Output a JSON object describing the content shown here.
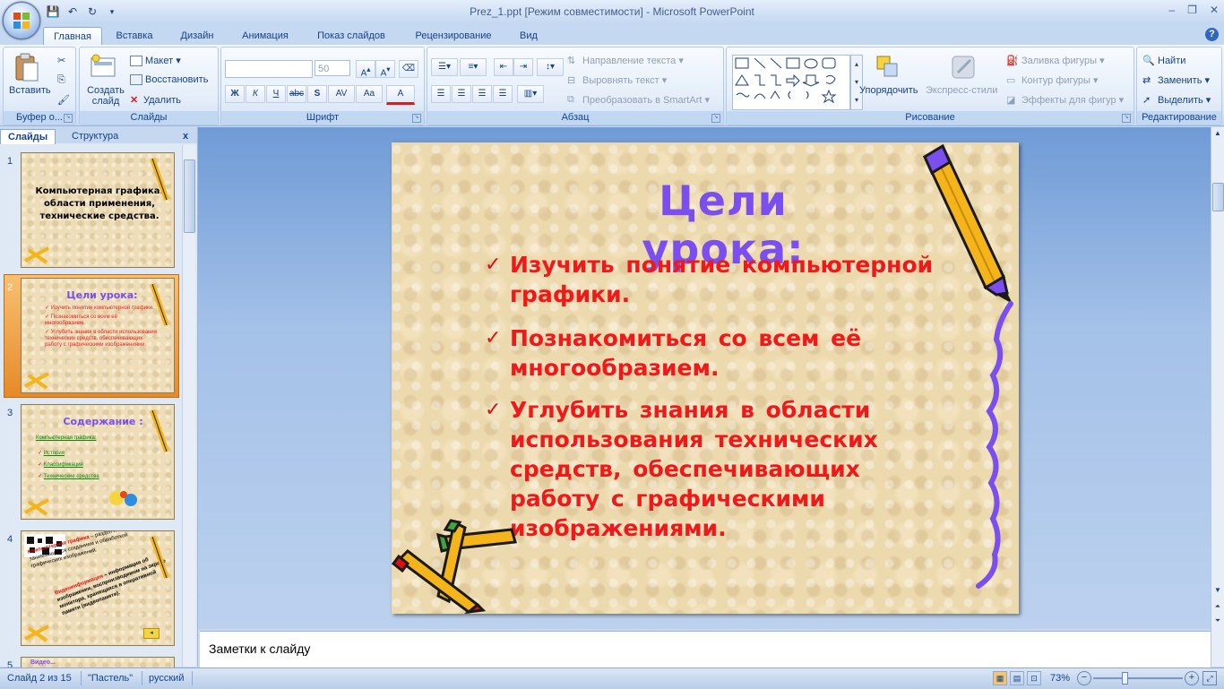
{
  "window": {
    "title": "Prez_1.ppt [Режим совместимости] - Microsoft PowerPoint",
    "controls": [
      "‒",
      "❐",
      "✕"
    ]
  },
  "tabs": [
    "Главная",
    "Вставка",
    "Дизайн",
    "Анимация",
    "Показ слайдов",
    "Рецензирование",
    "Вид"
  ],
  "ribbon": {
    "clipboard": {
      "paste": "Вставить",
      "group": "Буфер о..."
    },
    "slides": {
      "new_slide": "Создать слайд",
      "layout": "Макет",
      "reset": "Восстановить",
      "delete": "Удалить",
      "group": "Слайды"
    },
    "font": {
      "size": "50",
      "group": "Шрифт",
      "bold": "Ж",
      "italic": "К",
      "underline": "Ч",
      "strike": "abc",
      "shadow": "S",
      "spacing": "AV",
      "case": "Aa",
      "color": "A"
    },
    "paragraph": {
      "text_direction": "Направление текста",
      "align_text": "Выровнять текст",
      "smartart": "Преобразовать в SmartArt",
      "group": "Абзац"
    },
    "drawing": {
      "arrange": "Упорядочить",
      "quick_styles": "Экспресс-стили",
      "fill": "Заливка фигуры",
      "outline": "Контур фигуры",
      "effects": "Эффекты для фигур",
      "group": "Рисование"
    },
    "editing": {
      "find": "Найти",
      "replace": "Заменить",
      "select": "Выделить",
      "group": "Редактирование"
    }
  },
  "left_pane": {
    "tab_slides": "Слайды",
    "tab_outline": "Структура",
    "close": "x",
    "thumbnails": [
      {
        "num": "1",
        "text": "Компьютерная графика: области применения, технические средства."
      },
      {
        "num": "2",
        "title": "Цели урока:",
        "items": [
          "Изучить понятие компьютерной графики.",
          "Познакомиться со всем её многообразием.",
          "Углубить знания в области использования технических средств, обеспечивающих работу с графическими изображениями."
        ]
      },
      {
        "num": "3",
        "title": "Содержание :",
        "link": "Компьютерная графика:",
        "items": [
          "История",
          "Классификация",
          "Технические средства"
        ]
      },
      {
        "num": "4",
        "term1": "Компьютерная графика",
        "text1": "– раздел информатики, занимающийся созданием и обработкой графических изображений.",
        "term2": "Видеоинформация",
        "text2": "– информация об изображении, воспроизводимом на экране монитора, хранящаяся в оперативной памяти (видеопамяти)."
      },
      {
        "num": "5",
        "title": "Видео..."
      }
    ]
  },
  "slide": {
    "title": "Цели урока:",
    "bullets": [
      "Изучить понятие компьютерной графики.",
      "Познакомиться со всем её многообразием.",
      "Углубить знания в области использования технических средств, обеспечивающих работу с графическими изображениями."
    ],
    "bullet_color": "#f01818",
    "title_color": "#7b4ef0"
  },
  "notes": {
    "placeholder": "Заметки к слайду"
  },
  "status": {
    "slide_info": "Слайд 2 из 15",
    "theme": "\"Пастель\"",
    "language": "русский",
    "zoom": "73%"
  }
}
